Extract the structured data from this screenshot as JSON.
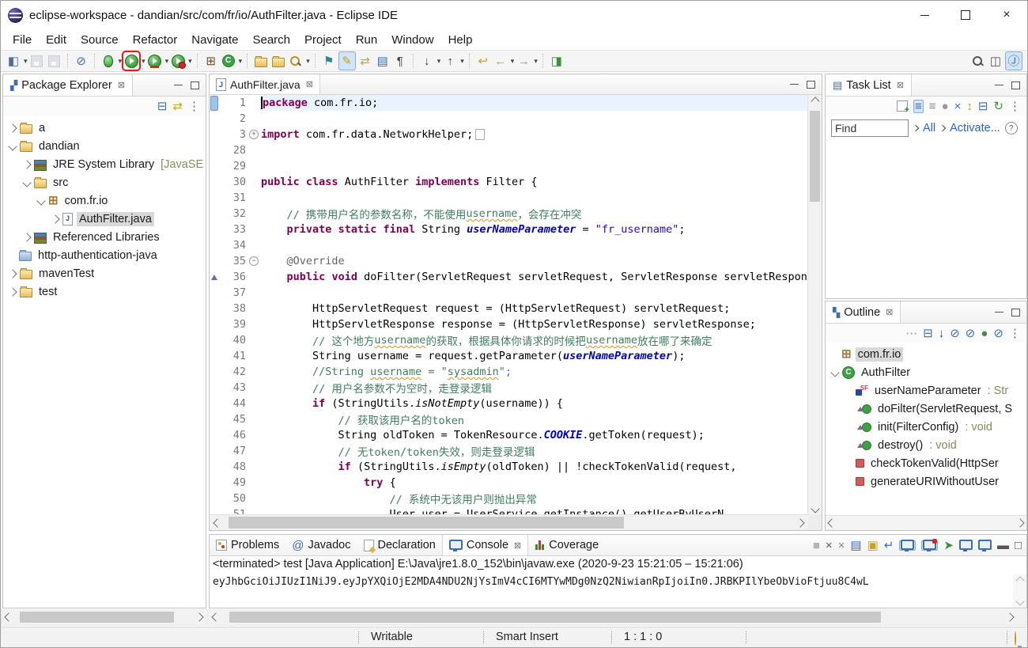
{
  "window": {
    "title": "eclipse-workspace - dandian/src/com/fr/io/AuthFilter.java - Eclipse IDE"
  },
  "menus": [
    "File",
    "Edit",
    "Source",
    "Refactor",
    "Navigate",
    "Search",
    "Project",
    "Run",
    "Window",
    "Help"
  ],
  "toolbar": {
    "groups": [
      [
        {
          "icon": "new-wizard",
          "dd": true
        },
        {
          "icon": "save",
          "disabled": true
        },
        {
          "icon": "save-all",
          "disabled": true
        }
      ],
      [
        {
          "icon": "skip-all-breakpoints"
        }
      ],
      [
        {
          "icon": "debug",
          "dd": true
        },
        {
          "icon": "run",
          "dd": true,
          "highlight": true
        },
        {
          "icon": "coverage",
          "dd": true
        },
        {
          "icon": "profile",
          "dd": true
        }
      ],
      [
        {
          "icon": "new-java-project"
        },
        {
          "icon": "new-class",
          "dd": true
        }
      ],
      [
        {
          "icon": "open-resource"
        },
        {
          "icon": "open-project"
        },
        {
          "icon": "search-torch",
          "dd": true
        }
      ],
      [
        {
          "icon": "show-annotation"
        },
        {
          "icon": "last-edit-location",
          "toggled": true
        },
        {
          "icon": "link-with-editor"
        },
        {
          "icon": "show-source"
        },
        {
          "icon": "show-whitespace"
        }
      ],
      [
        {
          "icon": "next-annotation",
          "dd": true
        },
        {
          "icon": "previous-annotation",
          "dd": true
        }
      ],
      [
        {
          "icon": "back-history"
        },
        {
          "icon": "back",
          "dd": true
        },
        {
          "icon": "forward",
          "dd": true
        }
      ],
      [
        {
          "icon": "open-new-view"
        }
      ]
    ],
    "right": [
      {
        "icon": "search"
      },
      {
        "icon": "open-perspective"
      },
      {
        "icon": "java-perspective",
        "toggled": true
      }
    ],
    "highlight_color": "#e01b1b"
  },
  "package_explorer": {
    "title": "Package Explorer",
    "toolbar": [
      "collapse-all",
      "link-with-editor",
      "view-menu"
    ],
    "items": [
      {
        "depth": 0,
        "exp": "c",
        "icon": "project",
        "label": "a"
      },
      {
        "depth": 0,
        "exp": "e",
        "icon": "project",
        "label": "dandian"
      },
      {
        "depth": 1,
        "exp": "c",
        "icon": "library",
        "label": "JRE System Library ",
        "decor": "[JavaSE"
      },
      {
        "depth": 1,
        "exp": "e",
        "icon": "src-folder",
        "label": "src"
      },
      {
        "depth": 2,
        "exp": "e",
        "icon": "package",
        "label": "com.fr.io"
      },
      {
        "depth": 3,
        "exp": "c",
        "icon": "java-file",
        "label": "AuthFilter.java",
        "selected": true
      },
      {
        "depth": 1,
        "exp": "c",
        "icon": "library",
        "label": "Referenced Libraries"
      },
      {
        "depth": 0,
        "exp": "",
        "icon": "folder-blue",
        "label": "http-authentication-java"
      },
      {
        "depth": 0,
        "exp": "c",
        "icon": "project",
        "label": "mavenTest"
      },
      {
        "depth": 0,
        "exp": "c",
        "icon": "project",
        "label": "test"
      }
    ]
  },
  "editor": {
    "tab_label": "AuthFilter.java",
    "lines": [
      {
        "n": "1",
        "cur": true,
        "caret": true,
        "tokens": [
          [
            "kw",
            "package"
          ],
          [
            "pl",
            " com.fr.io;"
          ]
        ]
      },
      {
        "n": "2",
        "tokens": []
      },
      {
        "n": "3",
        "fold": "+",
        "tokens": [
          [
            "kw",
            "import"
          ],
          [
            "pl",
            " com.fr.data.NetworkHelper;"
          ],
          [
            "box",
            ""
          ]
        ]
      },
      {
        "n": "28",
        "tokens": []
      },
      {
        "n": "29",
        "tokens": []
      },
      {
        "n": "30",
        "tokens": [
          [
            "kw",
            "public"
          ],
          [
            "pl",
            " "
          ],
          [
            "kw",
            "class"
          ],
          [
            "pl",
            " AuthFilter "
          ],
          [
            "kw",
            "implements"
          ],
          [
            "pl",
            " Filter {"
          ]
        ]
      },
      {
        "n": "31",
        "tokens": []
      },
      {
        "n": "32",
        "tokens": [
          [
            "com",
            "    // 携带用户名的参数名称，不能使用"
          ],
          [
            "com",
            "username",
            "wavy"
          ],
          [
            "com",
            "，会存在冲突"
          ]
        ]
      },
      {
        "n": "33",
        "tokens": [
          [
            "pl",
            "    "
          ],
          [
            "kw",
            "private"
          ],
          [
            "pl",
            " "
          ],
          [
            "kw",
            "static"
          ],
          [
            "pl",
            " "
          ],
          [
            "kw",
            "final"
          ],
          [
            "pl",
            " String "
          ],
          [
            "field",
            "userNameParameter"
          ],
          [
            "pl",
            " = "
          ],
          [
            "str",
            "\"fr_username\""
          ],
          [
            "pl",
            ";"
          ]
        ]
      },
      {
        "n": "34",
        "tokens": []
      },
      {
        "n": "35",
        "fold": "-",
        "tokens": [
          [
            "pl",
            "    "
          ],
          [
            "ann",
            "@Override"
          ]
        ]
      },
      {
        "n": "36",
        "warn": true,
        "tokens": [
          [
            "pl",
            "    "
          ],
          [
            "kw",
            "public"
          ],
          [
            "pl",
            " "
          ],
          [
            "kw",
            "void"
          ],
          [
            "pl",
            " doFilter(ServletRequest servletRequest, ServletResponse servletResponse"
          ]
        ]
      },
      {
        "n": "37",
        "tokens": []
      },
      {
        "n": "38",
        "tokens": [
          [
            "pl",
            "        HttpServletRequest request = (HttpServletRequest) servletRequest;"
          ]
        ]
      },
      {
        "n": "39",
        "tokens": [
          [
            "pl",
            "        HttpServletResponse response = (HttpServletResponse) servletResponse;"
          ]
        ]
      },
      {
        "n": "40",
        "tokens": [
          [
            "com",
            "        // 这个地方"
          ],
          [
            "com",
            "username",
            "wavy"
          ],
          [
            "com",
            "的获取，根据具体你请求的时候把"
          ],
          [
            "com",
            "username",
            "wavy"
          ],
          [
            "com",
            "放在哪了来确定"
          ]
        ]
      },
      {
        "n": "41",
        "tokens": [
          [
            "pl",
            "        String username = request.getParameter("
          ],
          [
            "field",
            "userNameParameter"
          ],
          [
            "pl",
            ");"
          ]
        ]
      },
      {
        "n": "42",
        "tokens": [
          [
            "com",
            "        //String "
          ],
          [
            "com",
            "username",
            "wavy"
          ],
          [
            "com",
            " = \""
          ],
          [
            "com",
            "sysadmin",
            "wavy"
          ],
          [
            "com",
            "\";"
          ]
        ]
      },
      {
        "n": "43",
        "tokens": [
          [
            "com",
            "        // 用户名参数不为空时，走登录逻辑"
          ]
        ]
      },
      {
        "n": "44",
        "tokens": [
          [
            "pl",
            "        "
          ],
          [
            "kw",
            "if"
          ],
          [
            "pl",
            " (StringUtils."
          ],
          [
            "sm",
            "isNotEmpty"
          ],
          [
            "pl",
            "(username)) {"
          ]
        ]
      },
      {
        "n": "45",
        "tokens": [
          [
            "com",
            "            // 获取该用户名的token"
          ]
        ]
      },
      {
        "n": "46",
        "tokens": [
          [
            "pl",
            "            String oldToken = TokenResource."
          ],
          [
            "field",
            "COOKIE"
          ],
          [
            "pl",
            ".getToken(request);"
          ]
        ]
      },
      {
        "n": "47",
        "tokens": [
          [
            "com",
            "            // 无token/token失效，则走登录逻辑"
          ]
        ]
      },
      {
        "n": "48",
        "tokens": [
          [
            "pl",
            "            "
          ],
          [
            "kw",
            "if"
          ],
          [
            "pl",
            " (StringUtils."
          ],
          [
            "sm",
            "isEmpty"
          ],
          [
            "pl",
            "(oldToken) || !checkTokenValid(request,"
          ]
        ]
      },
      {
        "n": "49",
        "tokens": [
          [
            "pl",
            "                "
          ],
          [
            "kw",
            "try"
          ],
          [
            "pl",
            " {"
          ]
        ]
      },
      {
        "n": "50",
        "tokens": [
          [
            "com",
            "                    // 系统中无该用户则抛出异常"
          ]
        ]
      },
      {
        "n": "51",
        "tokens": [
          [
            "pl",
            "                    User user = UserService.getInstance().getUserByUserN"
          ]
        ]
      }
    ]
  },
  "task_list": {
    "title": "Task List",
    "toolbar": [
      "new-task",
      "categorized-view",
      "scheduled-view",
      "presentation",
      "filter-completed",
      "sort",
      "collapse-all",
      "synchronize",
      "view-menu"
    ],
    "find_value": "Find",
    "links": [
      "All",
      "Activate..."
    ],
    "help_label": "?"
  },
  "outline": {
    "title": "Outline",
    "toolbar": [
      "focus",
      "collapse-all",
      "sort-az",
      "hide-fields",
      "hide-static",
      "hide-non-public",
      "hide-local-types",
      "view-menu"
    ],
    "items": [
      {
        "depth": 0,
        "exp": "",
        "icon": "package",
        "label": "com.fr.io",
        "selected": true
      },
      {
        "depth": 0,
        "exp": "e",
        "icon": "class",
        "label": "AuthFilter"
      },
      {
        "depth": 1,
        "exp": "",
        "icon": "field-sf",
        "label": "userNameParameter",
        "decor": " : Str"
      },
      {
        "depth": 1,
        "exp": "",
        "icon": "method-override",
        "label": "doFilter(ServletRequest, S"
      },
      {
        "depth": 1,
        "exp": "",
        "icon": "method-override",
        "label": "init(FilterConfig)",
        "decor": " : void"
      },
      {
        "depth": 1,
        "exp": "",
        "icon": "method-override",
        "label": "destroy()",
        "decor": " : void"
      },
      {
        "depth": 1,
        "exp": "",
        "icon": "method-private",
        "label": "checkTokenValid(HttpSer"
      },
      {
        "depth": 1,
        "exp": "",
        "icon": "method-private",
        "label": "generateURIWithoutUser"
      }
    ]
  },
  "console": {
    "tabs": [
      {
        "label": "Problems",
        "icon": "problems"
      },
      {
        "label": "Javadoc",
        "icon": "javadoc"
      },
      {
        "label": "Declaration",
        "icon": "declaration"
      },
      {
        "label": "Console",
        "icon": "console",
        "active": true,
        "closable": true
      },
      {
        "label": "Coverage",
        "icon": "coverage-tab"
      }
    ],
    "toolbar": [
      "stop",
      "clear",
      "remove-all-terminated",
      "copy",
      "scroll-lock",
      "word-wrap",
      "show-stdout",
      "show-stderr",
      "pin-console",
      "display-console",
      "open-console",
      "minimize-view",
      "maximize-view"
    ],
    "header": "<terminated> test [Java Application] E:\\Java\\jre1.8.0_152\\bin\\javaw.exe  (2020-9-23 15:21:05 – 15:21:06)",
    "output": "eyJhbGciOiJIUzI1NiJ9.eyJpYXQiOjE2MDA4NDU2NjYsImV4cCI6MTYwMDg0NzQ2NiwianRpIjoiIn0.JRBKPIlYbeObVioFtjuu8C4wL"
  },
  "status_bar": {
    "writable": "Writable",
    "insert_mode": "Smart Insert",
    "position": "1 : 1 : 0"
  },
  "colors": {
    "keyword": "#7f0055",
    "comment": "#3f7f5f",
    "string": "#2a00ff",
    "static_field": "#0000c0",
    "selection_bg": "#d9d9d9",
    "run_highlight": "#e01b1b",
    "link_blue": "#2a64c5"
  }
}
